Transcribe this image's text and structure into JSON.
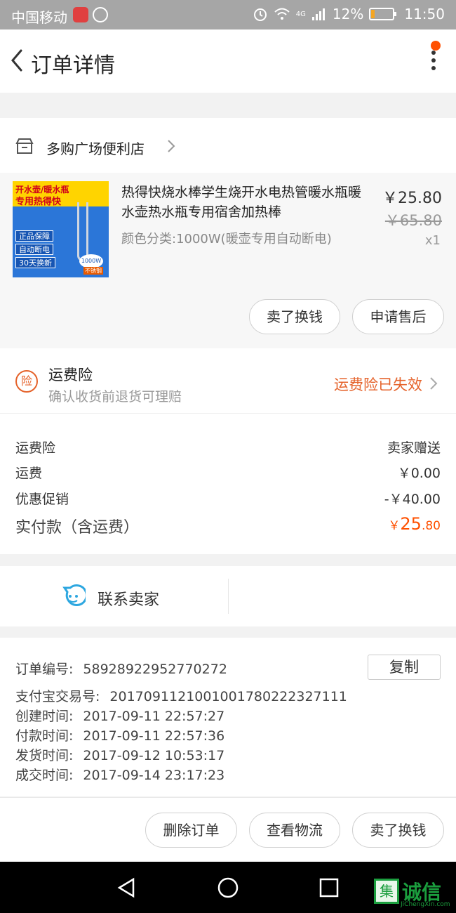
{
  "status_bar": {
    "carrier": "中国移动",
    "network": "4G",
    "battery": "12%",
    "time": "11:50"
  },
  "header": {
    "title": "订单详情"
  },
  "store": {
    "name": "多购广场便利店"
  },
  "product": {
    "title": "热得快烧水棒学生烧开水电热管暖水瓶暖水壶热水瓶专用宿舍加热棒",
    "sku": "颜色分类:1000W(暖壶专用自动断电)",
    "price": "￥25.80",
    "original_price": "￥65.80",
    "quantity": "x1",
    "thumb": {
      "line1": "开水壶/暖水瓶",
      "line2": "专用热得快",
      "tag1": "正品保障",
      "tag2": "自动断电",
      "tag3": "30天换新",
      "watt": "1000W",
      "steel": "不锈钢"
    },
    "sell_button": "卖了换钱",
    "aftersale_button": "申请售后"
  },
  "insurance": {
    "badge": "险",
    "title": "运费险",
    "subtitle": "确认收货前退货可理赔",
    "status": "运费险已失效"
  },
  "fees": {
    "rows": [
      {
        "label": "运费险",
        "value": "卖家赠送"
      },
      {
        "label": "运费",
        "value": "￥0.00"
      },
      {
        "label": "优惠促销",
        "value": "-￥40.00"
      }
    ],
    "paid_label": "实付款（含运费）",
    "paid_currency": "￥",
    "paid_int": "25",
    "paid_dec": ".80"
  },
  "contact": {
    "label": "联系卖家"
  },
  "order_info": {
    "order_no_label": "订单编号:",
    "order_no": "58928922952770272",
    "copy_button": "复制",
    "alipay_label": "支付宝交易号:",
    "alipay_no": "2017091121001001780222327111",
    "created_label": "创建时间:",
    "created": "2017-09-11 22:57:27",
    "paid_label": "付款时间:",
    "paid": "2017-09-11 22:57:36",
    "shipped_label": "发货时间:",
    "shipped": "2017-09-12 10:53:17",
    "closed_label": "成交时间:",
    "closed": "2017-09-14 23:17:23"
  },
  "actions": {
    "delete": "删除订单",
    "logistics": "查看物流",
    "sell": "卖了换钱"
  },
  "watermark": {
    "box": "集",
    "text": "诚信",
    "url": "JiChengXin.com"
  },
  "colors": {
    "accent": "#ff5000",
    "insurance": "#e5622a",
    "statusbar": "#a6a6a6"
  }
}
